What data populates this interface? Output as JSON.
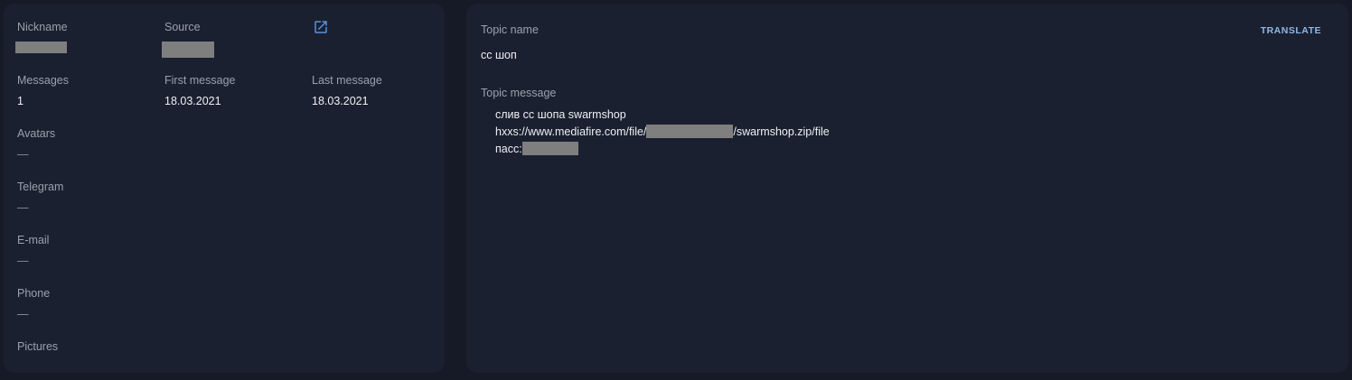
{
  "profile": {
    "nickname_label": "Nickname",
    "source_label": "Source",
    "external_link_icon": "external-link-icon",
    "messages_label": "Messages",
    "messages_value": "1",
    "first_message_label": "First message",
    "first_message_value": "18.03.2021",
    "last_message_label": "Last message",
    "last_message_value": "18.03.2021",
    "avatars_label": "Avatars",
    "avatars_value": "—",
    "telegram_label": "Telegram",
    "telegram_value": "—",
    "email_label": "E-mail",
    "email_value": "—",
    "phone_label": "Phone",
    "phone_value": "—",
    "pictures_label": "Pictures"
  },
  "topic": {
    "name_label": "Topic name",
    "name_value": "cc шоп",
    "translate_label": "TRANSLATE",
    "message_label": "Topic message",
    "message_line1": "слив cc шопа swarmshop",
    "message_line2_prefix": "hxxs://www.mediafire.com/file/",
    "message_line2_suffix": "/swarmshop.zip/file",
    "message_line3_prefix": "пасс:"
  },
  "colors": {
    "background": "#151a26",
    "panel": "#1b2030",
    "accent": "#8fb8e6",
    "icon_blue": "#5b8fd8",
    "redaction": "#7f7f7f"
  }
}
